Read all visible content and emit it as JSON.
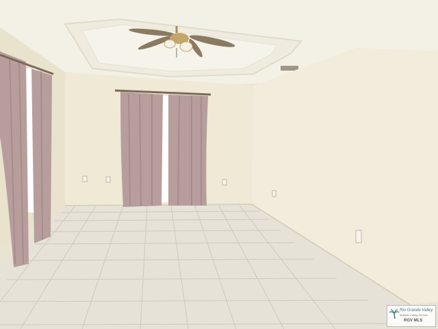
{
  "scene": {
    "description_type": "photo",
    "colors": {
      "wall": "#efe9d6",
      "wall_shadow": "#e3dcc6",
      "ceiling": "#f3f0e6",
      "floor": "#e6e2d8",
      "grout": "#cfc9bb",
      "curtain": "#b79e9c",
      "curtain_dark": "#9f8683",
      "window_light": "#ffffff",
      "fan_blade": "#8a7a62",
      "fan_brass": "#c2a66a"
    }
  },
  "watermark": {
    "brand": "Rio Grande Valley",
    "tagline": "Multiple Listing Service",
    "mls": "RGV MLS",
    "icon": "palm-tree-icon"
  }
}
